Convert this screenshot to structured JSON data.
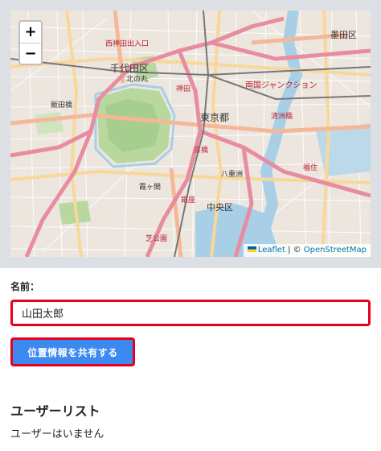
{
  "map": {
    "zoom_in_label": "+",
    "zoom_out_label": "−",
    "attribution_leaflet": "Leaflet",
    "attribution_separator": " | © ",
    "attribution_osm": "OpenStreetMap",
    "labels": {
      "chiyoda": "千代田区",
      "tokyo_station": "東京都",
      "chuo": "中央区",
      "sumida": "墨田区",
      "ryogoku": "両国ジャンクション",
      "kanda": "神田",
      "nishikanda": "西神田出入口",
      "jimbocho": "北の丸",
      "kyobashi": "京橋",
      "ginza": "銀座",
      "kiyosubashi": "清洲橋",
      "fukagawa": "福住",
      "yaesu": "八重洲",
      "kasumigaseki": "霞ヶ関",
      "shiba": "芝公園",
      "iidabashi": "飯田橋"
    },
    "colors": {
      "land": "#ece6df",
      "park": "#b8d8a0",
      "water": "#a8cfe6",
      "motorway": "#e88ca0",
      "trunk": "#f4b899",
      "primary": "#f8d89a",
      "rail": "#777777"
    }
  },
  "form": {
    "name_label": "名前：",
    "name_value": "山田太郎",
    "share_button_label": "位置情報を共有する"
  },
  "user_list": {
    "title": "ユーザーリスト",
    "empty_message": "ユーザーはいません"
  }
}
